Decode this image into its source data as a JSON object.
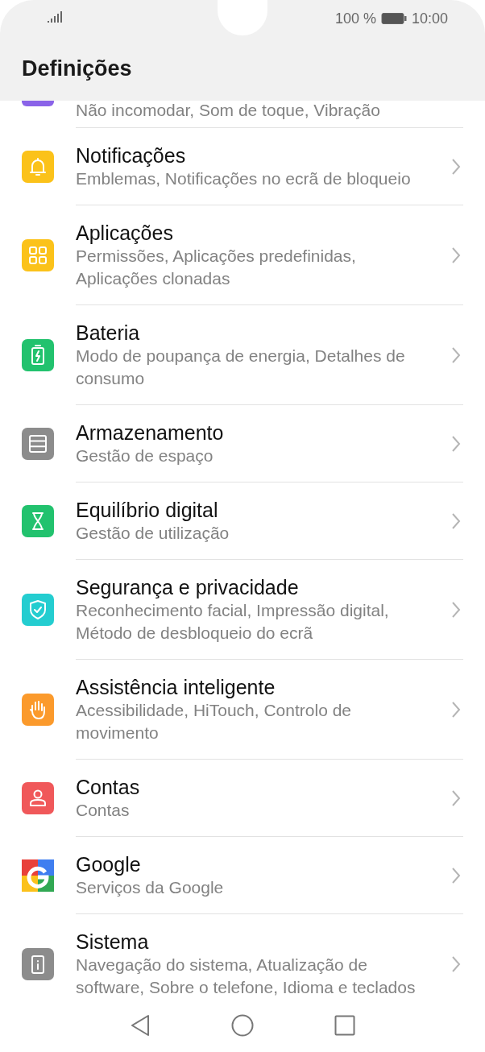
{
  "status_bar": {
    "battery": "100 %",
    "time": "10:00"
  },
  "title": "Definições",
  "items": [
    {
      "color": "#8a63e8",
      "subtitle": "Não incomodar, Som de toque, Vibração"
    },
    {
      "kind": "bell",
      "color": "#fbc21a",
      "title": "Notificações",
      "subtitle": "Emblemas, Notificações no ecrã de bloqueio"
    },
    {
      "kind": "grid",
      "color": "#fbc21a",
      "title": "Aplicações",
      "subtitle": "Permissões, Aplicações predefinidas, Aplicações clonadas"
    },
    {
      "kind": "battery",
      "color": "#22c26e",
      "title": "Bateria",
      "subtitle": "Modo de poupança de energia, Detalhes de consumo"
    },
    {
      "kind": "storage",
      "color": "#8c8c8c",
      "title": "Armazenamento",
      "subtitle": "Gestão de espaço"
    },
    {
      "kind": "hourglass",
      "color": "#22c26e",
      "title": "Equilíbrio digital",
      "subtitle": "Gestão de utilização"
    },
    {
      "kind": "shield",
      "color": "#24cdd0",
      "title": "Segurança e privacidade",
      "subtitle": "Reconhecimento facial, Impressão digital, Método de desbloqueio do ecrã"
    },
    {
      "kind": "hand",
      "color": "#fb9a2c",
      "title": "Assistência inteligente",
      "subtitle": "Acessibilidade, HiTouch, Controlo de movimento"
    },
    {
      "kind": "person",
      "color": "#f0585a",
      "title": "Contas",
      "subtitle": "Contas"
    },
    {
      "kind": "google",
      "title": "Google",
      "subtitle": "Serviços da Google"
    },
    {
      "kind": "info",
      "color": "#8c8c8c",
      "title": "Sistema",
      "subtitle": "Navegação do sistema, Atualização de software, Sobre o telefone, Idioma e teclados"
    }
  ]
}
